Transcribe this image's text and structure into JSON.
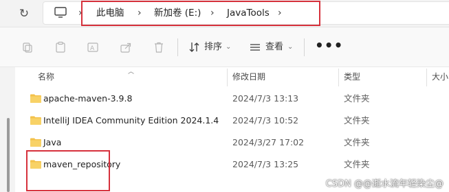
{
  "breadcrumb": {
    "items": [
      "此电脑",
      "新加卷 (E:)",
      "JavaTools"
    ]
  },
  "toolbar": {
    "sort_label": "排序",
    "view_label": "查看",
    "more_label": "•••"
  },
  "columns": {
    "name": "名称",
    "date": "修改日期",
    "type": "类型",
    "size": "大小"
  },
  "files": [
    {
      "name": "apache-maven-3.9.8",
      "date": "2024/7/3 13:13",
      "type": "文件夹"
    },
    {
      "name": "IntelliJ IDEA Community Edition 2024.1.4",
      "date": "2024/7/3 10:52",
      "type": "文件夹"
    },
    {
      "name": "Java",
      "date": "2024/3/27 17:02",
      "type": "文件夹"
    },
    {
      "name": "maven_repository",
      "date": "2024/7/3 13:25",
      "type": "文件夹"
    }
  ],
  "watermark": "CSDN @@逝水流年轻染尘@",
  "colors": {
    "highlight_box": "#d6303b",
    "folder": "#f3c14b"
  }
}
